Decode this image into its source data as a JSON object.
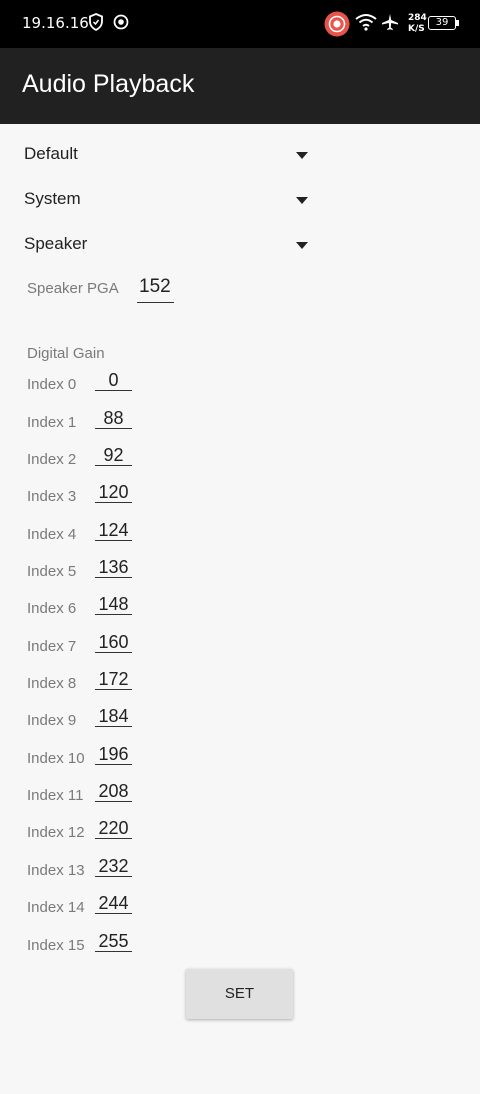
{
  "status_bar": {
    "time": "19.16.16",
    "net_speed_value": "284",
    "net_speed_unit": "K/S",
    "battery": "39",
    "icons": [
      "shield-icon",
      "record-icon",
      "screen-record-icon",
      "wifi-icon",
      "airplane-icon",
      "battery-icon"
    ]
  },
  "app_bar": {
    "title": "Audio Playback"
  },
  "spinners": [
    {
      "label": "Default"
    },
    {
      "label": "System"
    },
    {
      "label": "Speaker"
    }
  ],
  "speaker_pga": {
    "label": "Speaker PGA",
    "value": "152"
  },
  "digital_gain": {
    "label": "Digital Gain",
    "indices": [
      {
        "label": "Index 0",
        "value": "0"
      },
      {
        "label": "Index 1",
        "value": "88"
      },
      {
        "label": "Index 2",
        "value": "92"
      },
      {
        "label": "Index 3",
        "value": "120"
      },
      {
        "label": "Index 4",
        "value": "124"
      },
      {
        "label": "Index 5",
        "value": "136"
      },
      {
        "label": "Index 6",
        "value": "148"
      },
      {
        "label": "Index 7",
        "value": "160"
      },
      {
        "label": "Index 8",
        "value": "172"
      },
      {
        "label": "Index 9",
        "value": "184"
      },
      {
        "label": "Index 10",
        "value": "196"
      },
      {
        "label": "Index 11",
        "value": "208"
      },
      {
        "label": "Index 12",
        "value": "220"
      },
      {
        "label": "Index 13",
        "value": "232"
      },
      {
        "label": "Index 14",
        "value": "244"
      },
      {
        "label": "Index 15",
        "value": "255"
      }
    ]
  },
  "set_button": {
    "label": "SET"
  },
  "colors": {
    "status_bar": "#000000",
    "app_bar": "#212121",
    "background": "#f7f7f7",
    "record_accent": "#e8534a"
  }
}
